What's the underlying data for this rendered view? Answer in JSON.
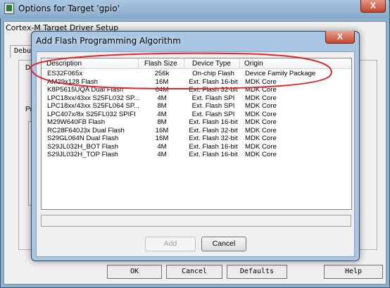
{
  "outer_window": {
    "title": "Options for Target 'gpio'",
    "close_glyph": "X",
    "panel_label": "Cortex-M Target Driver Setup",
    "tab_debug": "Debu",
    "frame_d_label": "D",
    "frame_p_label": "Pr",
    "buttons": {
      "ok": "OK",
      "cancel": "Cancel",
      "defaults": "Defaults",
      "help": "Help"
    }
  },
  "dialog": {
    "title": "Add Flash Programming Algorithm",
    "close_glyph": "X",
    "columns": [
      "Description",
      "Flash Size",
      "Device Type",
      "Origin"
    ],
    "rows": [
      [
        "ES32F065x",
        "256k",
        "On-chip Flash",
        "Device Family Package"
      ],
      [
        "AM29x128 Flash",
        "16M",
        "Ext. Flash 16-bit",
        "MDK Core"
      ],
      [
        "K8P5615UQA Dual Flash",
        "64M",
        "Ext. Flash 32-bit",
        "MDK Core"
      ],
      [
        "LPC18xx/43xx S25FL032 SP...",
        "4M",
        "Ext. Flash SPI",
        "MDK Core"
      ],
      [
        "LPC18xx/43xx S25FL064 SP...",
        "8M",
        "Ext. Flash SPI",
        "MDK Core"
      ],
      [
        "LPC407x/8x S25FL032 SPIFI",
        "4M",
        "Ext. Flash SPI",
        "MDK Core"
      ],
      [
        "M29W640FB Flash",
        "8M",
        "Ext. Flash 16-bit",
        "MDK Core"
      ],
      [
        "RC28F640J3x Dual Flash",
        "16M",
        "Ext. Flash 32-bit",
        "MDK Core"
      ],
      [
        "S29GL064N Dual Flash",
        "16M",
        "Ext. Flash 32-bit",
        "MDK Core"
      ],
      [
        "S29JL032H_BOT Flash",
        "4M",
        "Ext. Flash 16-bit",
        "MDK Core"
      ],
      [
        "S29JL032H_TOP Flash",
        "4M",
        "Ext. Flash 16-bit",
        "MDK Core"
      ]
    ],
    "buttons": {
      "add": "Add",
      "cancel": "Cancel"
    },
    "add_enabled": false
  },
  "colors": {
    "highlight": "#e0262b",
    "title_bar": "#a8c6e3",
    "close_button": "#c8472f"
  }
}
